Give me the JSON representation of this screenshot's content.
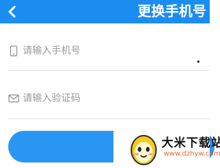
{
  "header": {
    "title": "更换手机号",
    "background": "#1b8cf0",
    "back_icon": "chevron-left-icon"
  },
  "form": {
    "phone": {
      "icon": "phone-icon",
      "placeholder": "请输入手机号",
      "value": ""
    },
    "code": {
      "icon": "envelope-icon",
      "placeholder": "请输入验证码",
      "value": ""
    },
    "submit_button": {
      "label": "",
      "color": "#2a96f3"
    }
  },
  "watermark": {
    "title": "大米下载站",
    "url": "www.dzhyw.com",
    "logo": "egg-mascot-logo"
  }
}
